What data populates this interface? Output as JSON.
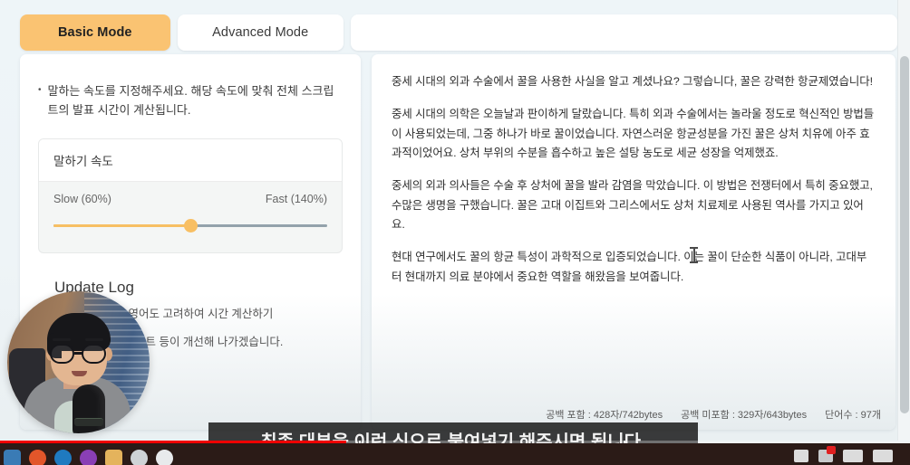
{
  "tabs": [
    {
      "label": "Basic Mode",
      "active": true
    },
    {
      "label": "Advanced Mode",
      "active": false
    },
    {
      "label": "",
      "active": false
    }
  ],
  "left_panel": {
    "bullet_note": "말하는 속도를 지정해주세요. 해당 속도에 맞춰 전체 스크립트의 발표 시간이 계산됩니다.",
    "speed_card": {
      "title": "말하기 속도",
      "min_label": "Slow (60%)",
      "max_label": "Fast (140%)",
      "value_percent": 50
    },
    "update_log": {
      "heading": "Update Log",
      "items": [
        "23-09-25 영어도 고려하여 시간 계산하기",
        "꾸준히 업데이트 등이 개선해 나가겠습니다."
      ]
    }
  },
  "right_panel": {
    "paragraphs": [
      "중세 시대의 외과 수술에서 꿀을 사용한 사실을 알고 계셨나요? 그렇습니다, 꿀은 강력한 항균제였습니다!",
      "중세 시대의 의학은 오늘날과 판이하게 달랐습니다. 특히 외과 수술에서는 놀라울 정도로 혁신적인 방법들이 사용되었는데, 그중 하나가 바로 꿀이었습니다. 자연스러운 항균성분을 가진 꿀은 상처 치유에 아주 효과적이었어요. 상처 부위의 수분을 흡수하고 높은 설탕 농도로 세균 성장을 억제했죠.",
      "중세의 외과 의사들은 수술 후 상처에 꿀을 발라 감염을 막았습니다. 이 방법은 전쟁터에서 특히 중요했고, 수많은 생명을 구했습니다. 꿀은 고대 이집트와 그리스에서도 상처 치료제로 사용된 역사를 가지고 있어요.",
      "현대 연구에서도 꿀의 항균 특성이 과학적으로 입증되었습니다. 이는 꿀이 단순한 식품이 아니라, 고대부터 현대까지 의료 분야에서 중요한 역할을 해왔음을 보여줍니다."
    ],
    "stats": {
      "with_spaces": "공백 포함 : 428자/742bytes",
      "without_spaces": "공백 미포함 : 329자/643bytes",
      "word_count": "단어수 : 97개"
    }
  },
  "video_overlay": {
    "subtitle": "최종 대본을 이런 식으로 붙여넣기 해주시면 됩니다.",
    "progress_percent": 38
  },
  "colors": {
    "accent_orange": "#fac372",
    "slider_fill": "#f7bf63",
    "slider_track": "#93a2ab",
    "page_background": "#eef5f8",
    "progress_red": "#f00000"
  }
}
